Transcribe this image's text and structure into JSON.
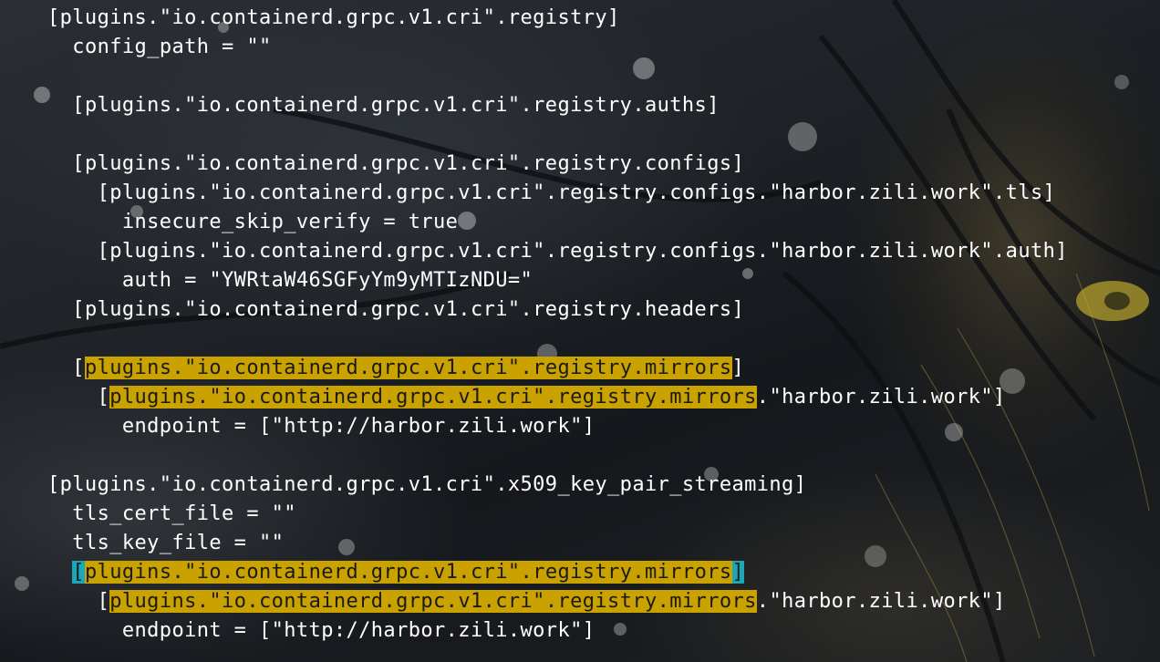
{
  "terminal": {
    "lines": [
      {
        "indent": "",
        "segments": [
          {
            "t": "[plugins.\"io.containerd.grpc.v1.cri\".registry]",
            "s": "n"
          }
        ]
      },
      {
        "indent": "  ",
        "segments": [
          {
            "t": "config_path = \"\"",
            "s": "n"
          }
        ]
      },
      {
        "indent": "",
        "segments": []
      },
      {
        "indent": "  ",
        "segments": [
          {
            "t": "[plugins.\"io.containerd.grpc.v1.cri\".registry.auths]",
            "s": "n"
          }
        ]
      },
      {
        "indent": "",
        "segments": []
      },
      {
        "indent": "  ",
        "segments": [
          {
            "t": "[plugins.\"io.containerd.grpc.v1.cri\".registry.configs]",
            "s": "n"
          }
        ]
      },
      {
        "indent": "    ",
        "segments": [
          {
            "t": "[plugins.\"io.containerd.grpc.v1.cri\".registry.configs.\"harbor.zili.work\".tls]",
            "s": "n"
          }
        ]
      },
      {
        "indent": "      ",
        "segments": [
          {
            "t": "insecure_skip_verify = true",
            "s": "n"
          }
        ]
      },
      {
        "indent": "    ",
        "segments": [
          {
            "t": "[plugins.\"io.containerd.grpc.v1.cri\".registry.configs.\"harbor.zili.work\".auth]",
            "s": "n"
          }
        ]
      },
      {
        "indent": "      ",
        "segments": [
          {
            "t": "auth = \"YWRtaW46SGFyYm9yMTIzNDU=\"",
            "s": "n"
          }
        ]
      },
      {
        "indent": "  ",
        "segments": [
          {
            "t": "[plugins.\"io.containerd.grpc.v1.cri\".registry.headers]",
            "s": "n"
          }
        ]
      },
      {
        "indent": "",
        "segments": []
      },
      {
        "indent": "  ",
        "segments": [
          {
            "t": "[",
            "s": "n"
          },
          {
            "t": "plugins.\"io.containerd.grpc.v1.cri\".registry.mirrors",
            "s": "h"
          },
          {
            "t": "]",
            "s": "n"
          }
        ]
      },
      {
        "indent": "    ",
        "segments": [
          {
            "t": "[",
            "s": "n"
          },
          {
            "t": "plugins.\"io.containerd.grpc.v1.cri\".registry.mirrors",
            "s": "h"
          },
          {
            "t": ".\"harbor.zili.work\"]",
            "s": "n"
          }
        ]
      },
      {
        "indent": "      ",
        "segments": [
          {
            "t": "endpoint = [\"http://harbor.zili.work\"]",
            "s": "n"
          }
        ]
      },
      {
        "indent": "",
        "segments": []
      },
      {
        "indent": "",
        "segments": [
          {
            "t": "[plugins.\"io.containerd.grpc.v1.cri\".x509_key_pair_streaming]",
            "s": "n"
          }
        ]
      },
      {
        "indent": "  ",
        "segments": [
          {
            "t": "tls_cert_file = \"\"",
            "s": "n"
          }
        ]
      },
      {
        "indent": "  ",
        "segments": [
          {
            "t": "tls_key_file = \"\"",
            "s": "n"
          }
        ]
      },
      {
        "indent": "  ",
        "segments": [
          {
            "t": "[",
            "s": "c"
          },
          {
            "t": "plugins.\"io.containerd.grpc.v1.cri\".registry.mirrors",
            "s": "h"
          },
          {
            "t": "]",
            "s": "c"
          }
        ]
      },
      {
        "indent": "    ",
        "segments": [
          {
            "t": "[",
            "s": "n"
          },
          {
            "t": "plugins.\"io.containerd.grpc.v1.cri\".registry.mirrors",
            "s": "h"
          },
          {
            "t": ".\"harbor.zili.work\"]",
            "s": "n"
          }
        ]
      },
      {
        "indent": "      ",
        "segments": [
          {
            "t": "endpoint = [\"http://harbor.zili.work\"]",
            "s": "n"
          }
        ]
      }
    ]
  },
  "colors": {
    "text": "#ffffff",
    "highlight": "#c9a200",
    "cursor": "#1aa7b8"
  }
}
